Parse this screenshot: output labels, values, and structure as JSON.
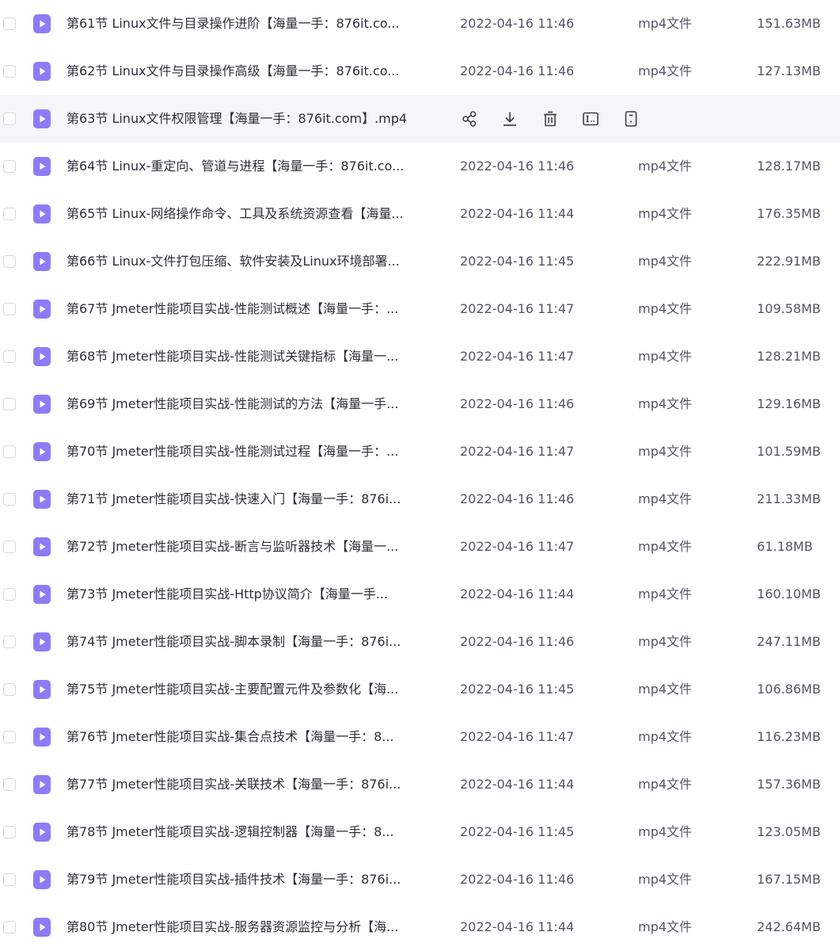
{
  "colors": {
    "file_icon": "#8c7cf6",
    "hover_row": "#f5f6f8"
  },
  "icons": {
    "file": "video-file-icon",
    "share": "share-icon",
    "download": "download-icon",
    "delete": "trash-icon",
    "rename": "rename-icon",
    "more": "detail-icon"
  },
  "files": [
    {
      "name": "第61节 Linux文件与目录操作进阶【海量一手：876it.co...",
      "date": "2022-04-16 11:46",
      "type": "mp4文件",
      "size": "151.63MB"
    },
    {
      "name": "第62节 Linux文件与目录操作高级【海量一手：876it.co...",
      "date": "2022-04-16 11:46",
      "type": "mp4文件",
      "size": "127.13MB"
    },
    {
      "name": "第63节 Linux文件权限管理【海量一手：876it.com】.mp4",
      "date": "",
      "type": "",
      "size": "",
      "hover": true
    },
    {
      "name": "第64节 Linux-重定向、管道与进程【海量一手：876it.co...",
      "date": "2022-04-16 11:46",
      "type": "mp4文件",
      "size": "128.17MB"
    },
    {
      "name": "第65节 Linux-网络操作命令、工具及系统资源查看【海量...",
      "date": "2022-04-16 11:44",
      "type": "mp4文件",
      "size": "176.35MB"
    },
    {
      "name": "第66节 Linux-文件打包压缩、软件安装及Linux环境部署...",
      "date": "2022-04-16 11:45",
      "type": "mp4文件",
      "size": "222.91MB"
    },
    {
      "name": "第67节 Jmeter性能项目实战-性能测试概述【海量一手：...",
      "date": "2022-04-16 11:47",
      "type": "mp4文件",
      "size": "109.58MB"
    },
    {
      "name": "第68节 Jmeter性能项目实战-性能测试关键指标【海量一...",
      "date": "2022-04-16 11:47",
      "type": "mp4文件",
      "size": "128.21MB"
    },
    {
      "name": "第69节 Jmeter性能项目实战-性能测试的方法【海量一手...",
      "date": "2022-04-16 11:46",
      "type": "mp4文件",
      "size": "129.16MB"
    },
    {
      "name": "第70节 Jmeter性能项目实战-性能测试过程【海量一手：...",
      "date": "2022-04-16 11:47",
      "type": "mp4文件",
      "size": "101.59MB"
    },
    {
      "name": "第71节 Jmeter性能项目实战-快速入门【海量一手：876i...",
      "date": "2022-04-16 11:46",
      "type": "mp4文件",
      "size": "211.33MB"
    },
    {
      "name": "第72节 Jmeter性能项目实战-断言与监听器技术【海量一...",
      "date": "2022-04-16 11:47",
      "type": "mp4文件",
      "size": "61.18MB"
    },
    {
      "name": "第73节 Jmeter性能项目实战-Http协议简介【海量一手...",
      "date": "2022-04-16 11:44",
      "type": "mp4文件",
      "size": "160.10MB"
    },
    {
      "name": "第74节 Jmeter性能项目实战-脚本录制【海量一手：876i...",
      "date": "2022-04-16 11:46",
      "type": "mp4文件",
      "size": "247.11MB"
    },
    {
      "name": "第75节 Jmeter性能项目实战-主要配置元件及参数化【海...",
      "date": "2022-04-16 11:45",
      "type": "mp4文件",
      "size": "106.86MB"
    },
    {
      "name": "第76节 Jmeter性能项目实战-集合点技术【海量一手：8...",
      "date": "2022-04-16 11:47",
      "type": "mp4文件",
      "size": "116.23MB"
    },
    {
      "name": "第77节 Jmeter性能项目实战-关联技术【海量一手：876i...",
      "date": "2022-04-16 11:44",
      "type": "mp4文件",
      "size": "157.36MB"
    },
    {
      "name": "第78节 Jmeter性能项目实战-逻辑控制器【海量一手：8...",
      "date": "2022-04-16 11:45",
      "type": "mp4文件",
      "size": "123.05MB"
    },
    {
      "name": "第79节 Jmeter性能项目实战-插件技术【海量一手：876i...",
      "date": "2022-04-16 11:46",
      "type": "mp4文件",
      "size": "167.15MB"
    },
    {
      "name": "第80节 Jmeter性能项目实战-服务器资源监控与分析【海...",
      "date": "2022-04-16 11:44",
      "type": "mp4文件",
      "size": "242.64MB"
    }
  ]
}
